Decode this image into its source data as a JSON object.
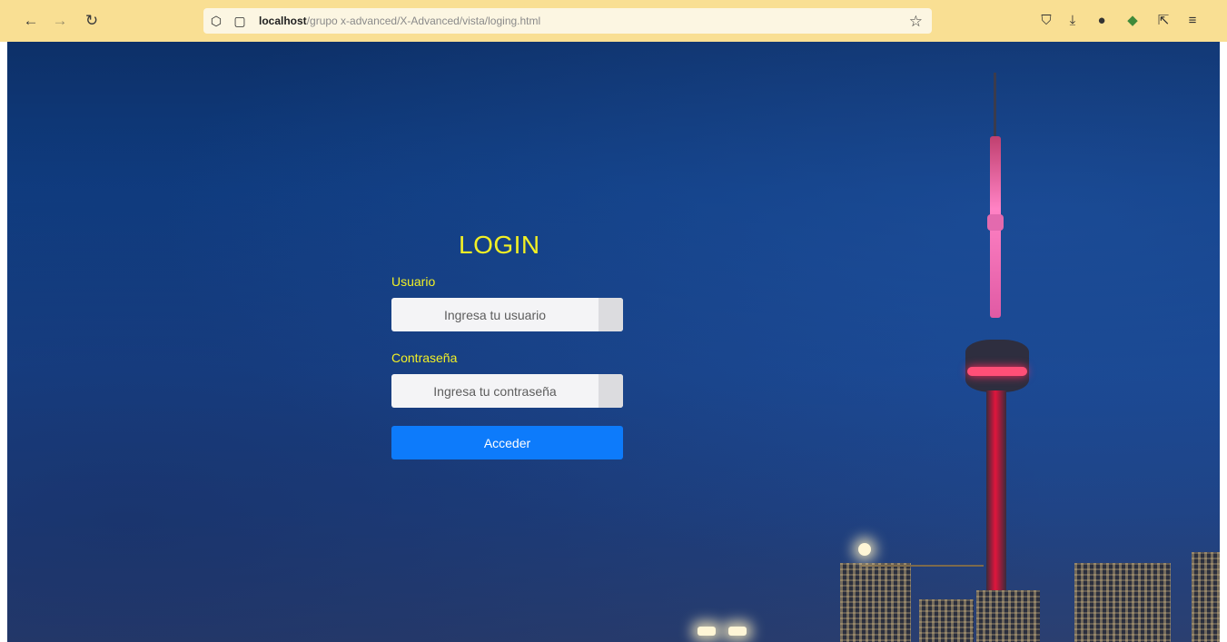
{
  "browser": {
    "url_host": "localhost",
    "url_path": "/grupo x-advanced/X-Advanced/vista/loging.html",
    "toolbar_color": "#f9df93"
  },
  "icons": {
    "back": "←",
    "forward": "→",
    "reload": "↻",
    "shield": "⬡",
    "page": "▢",
    "star": "☆",
    "pocket": "⛉",
    "download": "⤓",
    "profile": "●",
    "extension": "◆",
    "share": "⇱",
    "menu": "≡"
  },
  "login": {
    "title": "LOGIN",
    "username_label": "Usuario",
    "username_placeholder": "Ingresa tu usuario",
    "password_label": "Contraseña",
    "password_placeholder": "Ingresa tu contraseña",
    "submit_label": "Acceder",
    "accent_color": "#f2f025",
    "button_color": "#0d7bfb"
  }
}
